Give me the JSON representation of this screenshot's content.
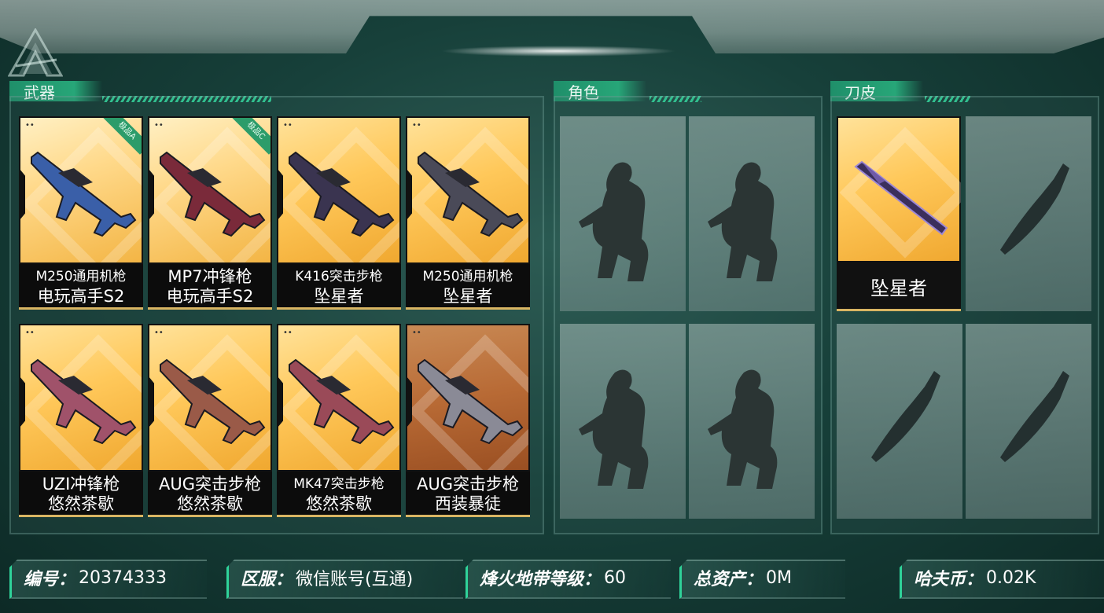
{
  "sections": {
    "weapons": "武器",
    "characters": "角色",
    "knife_skins": "刀皮"
  },
  "weapons": [
    {
      "line1": "M250通用机枪",
      "line2": "电玩高手S2",
      "badge": "极品A",
      "style": "light"
    },
    {
      "line1": "MP7冲锋枪",
      "line2": "电玩高手S2",
      "badge": "极品C",
      "style": "light"
    },
    {
      "line1": "K416突击步枪",
      "line2": "坠星者",
      "badge": "",
      "style": "gold"
    },
    {
      "line1": "M250通用机枪",
      "line2": "坠星者",
      "badge": "",
      "style": "gold"
    },
    {
      "line1": "UZI冲锋枪",
      "line2": "悠然茶歇",
      "badge": "",
      "style": "gold"
    },
    {
      "line1": "AUG突击步枪",
      "line2": "悠然茶歇",
      "badge": "",
      "style": "gold"
    },
    {
      "line1": "MK47突击步枪",
      "line2": "悠然茶歇",
      "badge": "",
      "style": "gold"
    },
    {
      "line1": "AUG突击步枪",
      "line2": "西装暴徒",
      "badge": "",
      "style": "orange"
    }
  ],
  "knife": {
    "name": "坠星者"
  },
  "info": {
    "id_label": "编号：",
    "id_value": "20374333",
    "server_label": "区服：",
    "server_value": "微信账号(互通)",
    "level_label": "烽火地带等级：",
    "level_value": "60",
    "assets_label": "总资产：",
    "assets_value": "0M",
    "coin_label": "哈夫币：",
    "coin_value": "0.02K"
  },
  "colors": {
    "accent": "#2fd39a",
    "tab": "#27a678",
    "card_gold": "#ffc85a",
    "card_orange": "#b86a35"
  }
}
